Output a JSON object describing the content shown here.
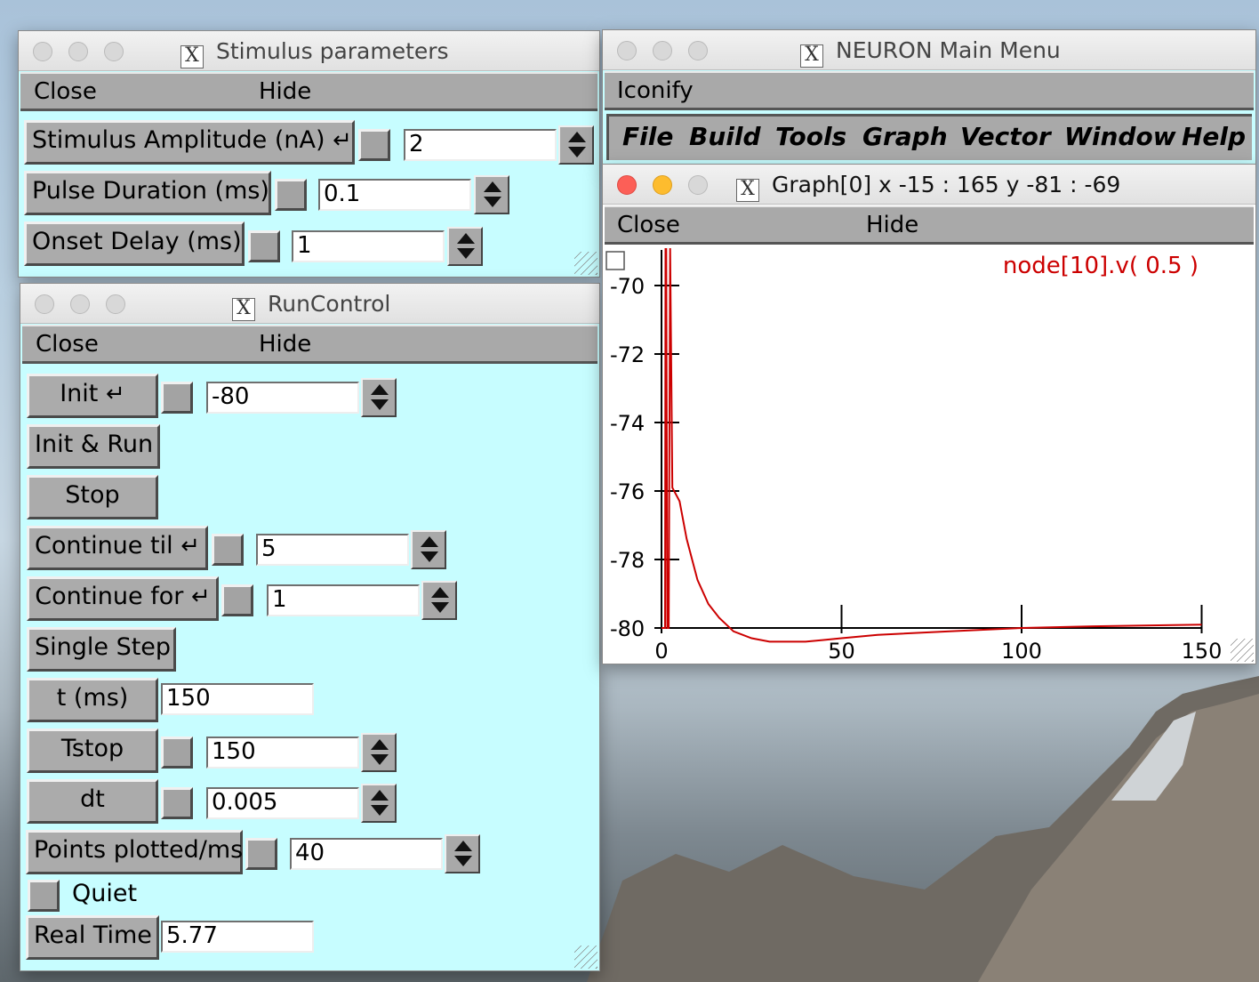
{
  "desktop": {
    "background": "mountain-landscape"
  },
  "stim": {
    "title": "Stimulus parameters",
    "menu": {
      "close": "Close",
      "hide": "Hide"
    },
    "rows": [
      {
        "label": "Stimulus Amplitude (nA)",
        "has_return": true,
        "value": "2"
      },
      {
        "label": "Pulse Duration (ms)",
        "has_return": false,
        "value": "0.1"
      },
      {
        "label": "Onset Delay (ms)",
        "has_return": false,
        "value": "1"
      }
    ]
  },
  "run": {
    "title": "RunControl",
    "menu": {
      "close": "Close",
      "hide": "Hide"
    },
    "init": {
      "label": "Init",
      "value": "-80"
    },
    "init_run": "Init & Run",
    "stop": "Stop",
    "continue_til": {
      "label": "Continue til",
      "value": "5"
    },
    "continue_for": {
      "label": "Continue for",
      "value": "1"
    },
    "single_step": "Single Step",
    "t": {
      "label": "t (ms)",
      "value": "150"
    },
    "tstop": {
      "label": "Tstop",
      "value": "150"
    },
    "dt": {
      "label": "dt",
      "value": "0.005"
    },
    "points": {
      "label": "Points plotted/ms",
      "value": "40"
    },
    "quiet": "Quiet",
    "realtime": {
      "label": "Real Time",
      "value": "5.77"
    }
  },
  "main": {
    "title": "NEURON Main Menu",
    "iconify": "Iconify",
    "menus": [
      "File",
      "Build",
      "Tools",
      "Graph",
      "Vector",
      "Window",
      "Help"
    ]
  },
  "graph": {
    "title": "Graph[0]  x -15 : 165  y -81 : -69",
    "menu": {
      "close": "Close",
      "hide": "Hide"
    },
    "trace_label": "node[10].v( 0.5 )",
    "trace_color": "#cc0000",
    "chart_data": {
      "type": "line",
      "xlim": [
        -15,
        165
      ],
      "ylim": [
        -81,
        -69
      ],
      "x_ticks": [
        0,
        50,
        100,
        150
      ],
      "y_ticks": [
        -70,
        -72,
        -74,
        -76,
        -78,
        -80
      ],
      "series": [
        {
          "name": "node[10].v( 0.5 )",
          "x": [
            0,
            1,
            1.1,
            1.3,
            1.6,
            2,
            2.4,
            3,
            5,
            7,
            10,
            13,
            16,
            20,
            25,
            30,
            35,
            40,
            45,
            50,
            60,
            80,
            100,
            120,
            140,
            150
          ],
          "y": [
            -80,
            -80,
            -69,
            -69,
            -80,
            -80,
            -69,
            -75.9,
            -76.3,
            -77.4,
            -78.6,
            -79.3,
            -79.7,
            -80.1,
            -80.3,
            -80.4,
            -80.4,
            -80.4,
            -80.35,
            -80.3,
            -80.2,
            -80.1,
            -80.0,
            -79.95,
            -79.92,
            -79.9
          ]
        }
      ]
    }
  }
}
